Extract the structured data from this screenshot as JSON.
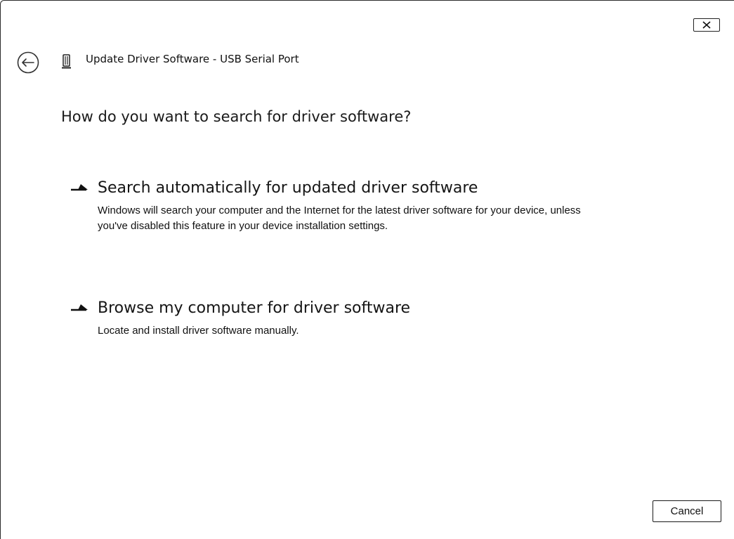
{
  "window": {
    "title": "Update Driver Software - USB Serial Port"
  },
  "icons": {
    "back": "back-arrow-icon",
    "device": "usb-device-icon",
    "close": "close-icon",
    "option_arrow": "right-arrow-icon"
  },
  "heading": "How do you want to search for driver software?",
  "options": [
    {
      "title": "Search automatically for updated driver software",
      "description": "Windows will search your computer and the Internet for the latest driver software for your device, unless you've disabled this feature in your device installation settings."
    },
    {
      "title": "Browse my computer for driver software",
      "description": "Locate and install driver software manually."
    }
  ],
  "footer": {
    "cancel_label": "Cancel"
  }
}
